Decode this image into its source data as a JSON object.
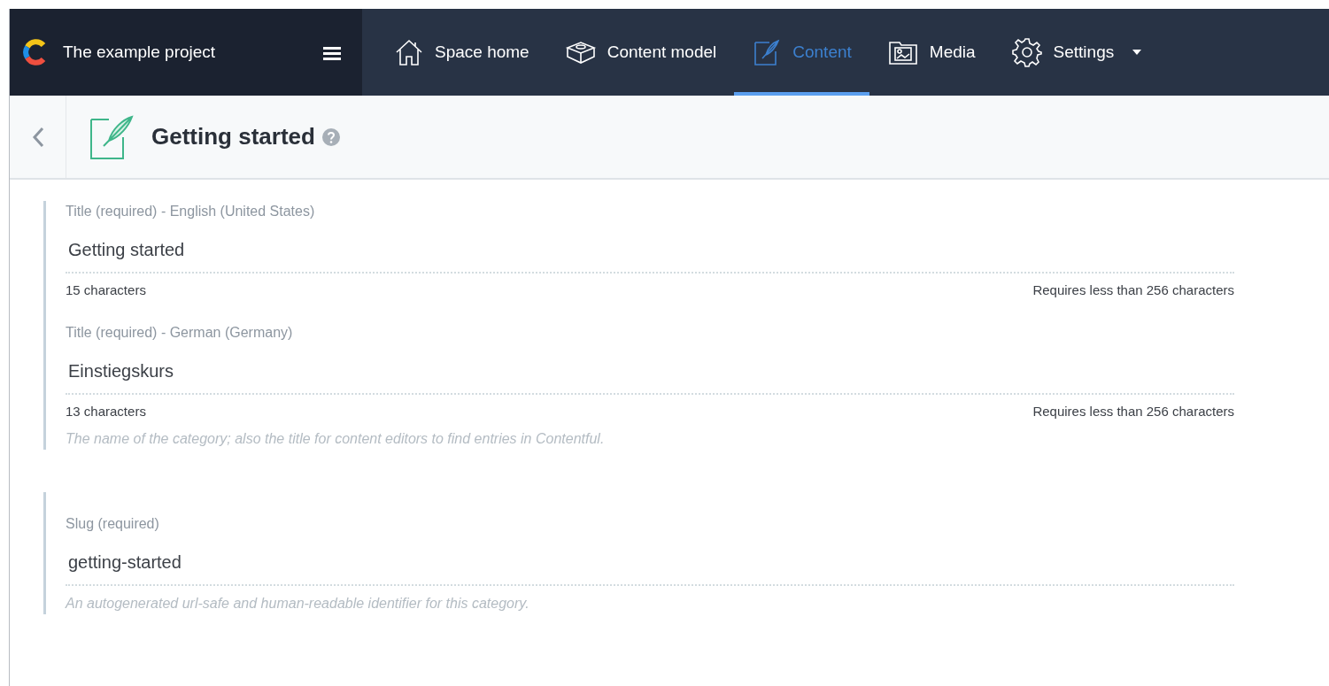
{
  "sidebar": {
    "project": "The example project"
  },
  "nav": [
    {
      "label": "Space home",
      "selected": false,
      "dropdown": false
    },
    {
      "label": "Content model",
      "selected": false,
      "dropdown": false
    },
    {
      "label": "Content",
      "selected": true,
      "dropdown": false
    },
    {
      "label": "Media",
      "selected": false,
      "dropdown": false
    },
    {
      "label": "Settings",
      "selected": false,
      "dropdown": true
    }
  ],
  "header": {
    "title": "Getting started"
  },
  "field_groups": [
    {
      "fields": [
        {
          "label": "Title (required) - English (United States)",
          "value": "Getting started",
          "count": "15 characters",
          "limit": "Requires less than 256 characters"
        },
        {
          "label": "Title (required) - German (Germany)",
          "value": "Einstiegskurs",
          "count": "13 characters",
          "limit": "Requires less than 256 characters"
        }
      ],
      "help": "The name of the category; also the title for content editors to find entries in Contentful."
    },
    {
      "fields": [
        {
          "label": "Slug (required)",
          "value": "getting-started"
        }
      ],
      "help": "An autogenerated url-safe and human-readable identifier for this category."
    }
  ]
}
